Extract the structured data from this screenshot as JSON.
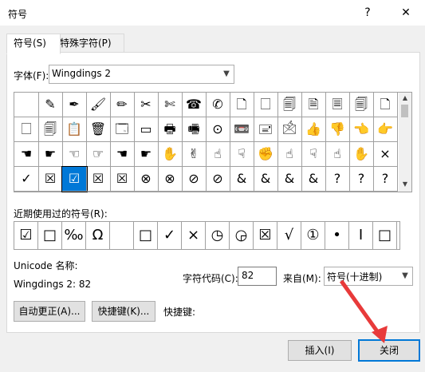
{
  "window": {
    "title": "符号",
    "help": "?",
    "close": "✕"
  },
  "tabs": [
    "符号(S)",
    "特殊字符(P)"
  ],
  "font": {
    "label": "字体(F):",
    "value": "Wingdings 2"
  },
  "grid": {
    "rows": [
      [
        " ",
        "✎",
        "✒",
        "🖌",
        "✏",
        "✂",
        "✄",
        "☎",
        "✆",
        "🗋",
        "🗌",
        "🗐",
        "🗎",
        "🗏",
        "🗐",
        "🗋"
      ],
      [
        "🗌",
        "🗐",
        "📋",
        "🗑",
        "🗔",
        "▭",
        "🖶",
        "🖷",
        "⊙",
        "📼",
        "🖃",
        "🖄",
        "👍",
        "👎",
        "👈",
        "👉"
      ],
      [
        "☚",
        "☛",
        "☜",
        "☞",
        "☚",
        "☛",
        "✋",
        "✌",
        "☝",
        "☟",
        "✊",
        "☝",
        "☟",
        "☝",
        "✋",
        "×"
      ],
      [
        "✓",
        "☒",
        "☑",
        "☒",
        "☒",
        "⊗",
        "⊗",
        "⊘",
        "⊘",
        "&",
        "&",
        "&",
        "&",
        "?",
        "?",
        "?"
      ]
    ],
    "selected": {
      "row": 3,
      "col": 2
    }
  },
  "recent": {
    "label": "近期使用过的符号(R):",
    "symbols": [
      "☑",
      "□",
      "‰",
      "Ω",
      "",
      "□",
      "✓",
      "×",
      "◷",
      "◶",
      "☒",
      "√",
      "①",
      "•",
      "I",
      "□"
    ]
  },
  "unicode": {
    "name_label": "Unicode 名称:",
    "name_value": "Wingdings 2: 82"
  },
  "charcode": {
    "label": "字符代码(C):",
    "value": "82",
    "from_label": "来自(M):",
    "from_value": "符号(十进制)"
  },
  "buttons": {
    "autocorrect": "自动更正(A)...",
    "shortcut_key": "快捷键(K)...",
    "shortcut_label": "快捷键:",
    "insert": "插入(I)",
    "close": "关闭"
  },
  "colors": {
    "accent": "#0078d7",
    "annotation": "#e83a3a"
  }
}
